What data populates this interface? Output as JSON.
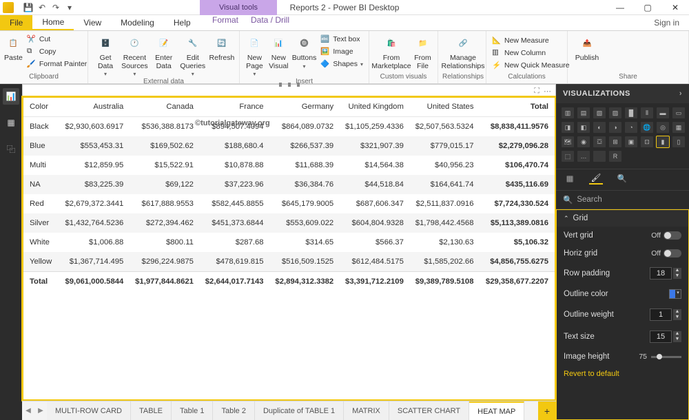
{
  "titlebar": {
    "visual_tools": "Visual tools",
    "app_title": "Reports 2 - Power BI Desktop"
  },
  "menu": {
    "file": "File",
    "tabs": [
      "Home",
      "View",
      "Modeling",
      "Help"
    ],
    "purple_tabs": [
      "Format",
      "Data / Drill"
    ],
    "signin": "Sign in"
  },
  "ribbon": {
    "clipboard": {
      "label": "Clipboard",
      "paste": "Paste",
      "cut": "Cut",
      "copy": "Copy",
      "format_painter": "Format Painter"
    },
    "external": {
      "label": "External data",
      "get_data": "Get\nData",
      "recent": "Recent\nSources",
      "enter": "Enter\nData",
      "edit": "Edit\nQueries",
      "refresh": "Refresh"
    },
    "insert": {
      "label": "Insert",
      "new_page": "New\nPage",
      "new_visual": "New\nVisual",
      "buttons": "Buttons",
      "text_box": "Text box",
      "image": "Image",
      "shapes": "Shapes"
    },
    "custom": {
      "label": "Custom visuals",
      "marketplace": "From\nMarketplace",
      "file": "From\nFile"
    },
    "relationships": {
      "label": "Relationships",
      "manage": "Manage\nRelationships"
    },
    "calc": {
      "label": "Calculations",
      "new_measure": "New Measure",
      "new_column": "New Column",
      "new_quick": "New Quick Measure"
    },
    "share": {
      "label": "Share",
      "publish": "Publish"
    }
  },
  "matrix": {
    "watermark": "©tutorialgateway.org",
    "row_header": "Color",
    "columns": [
      "Australia",
      "Canada",
      "France",
      "Germany",
      "United Kingdom",
      "United States",
      "Total"
    ],
    "rows": [
      {
        "k": "Black",
        "v": [
          "$2,930,603.6917",
          "$536,388.8173",
          "$894,507.4094",
          "$864,089.0732",
          "$1,105,259.4336",
          "$2,507,563.5324",
          "$8,838,411.9576"
        ]
      },
      {
        "k": "Blue",
        "v": [
          "$553,453.31",
          "$169,502.62",
          "$188,680.4",
          "$266,537.39",
          "$321,907.39",
          "$779,015.17",
          "$2,279,096.28"
        ]
      },
      {
        "k": "Multi",
        "v": [
          "$12,859.95",
          "$15,522.91",
          "$10,878.88",
          "$11,688.39",
          "$14,564.38",
          "$40,956.23",
          "$106,470.74"
        ]
      },
      {
        "k": "NA",
        "v": [
          "$83,225.39",
          "$69,122",
          "$37,223.96",
          "$36,384.76",
          "$44,518.84",
          "$164,641.74",
          "$435,116.69"
        ]
      },
      {
        "k": "Red",
        "v": [
          "$2,679,372.3441",
          "$617,888.9553",
          "$582,445.8855",
          "$645,179.9005",
          "$687,606.347",
          "$2,511,837.0916",
          "$7,724,330.524"
        ]
      },
      {
        "k": "Silver",
        "v": [
          "$1,432,764.5236",
          "$272,394.462",
          "$451,373.6844",
          "$553,609.022",
          "$604,804.9328",
          "$1,798,442.4568",
          "$5,113,389.0816"
        ]
      },
      {
        "k": "White",
        "v": [
          "$1,006.88",
          "$800.11",
          "$287.68",
          "$314.65",
          "$566.37",
          "$2,130.63",
          "$5,106.32"
        ]
      },
      {
        "k": "Yellow",
        "v": [
          "$1,367,714.495",
          "$296,224.9875",
          "$478,619.815",
          "$516,509.1525",
          "$612,484.5175",
          "$1,585,202.66",
          "$4,856,755.6275"
        ]
      }
    ],
    "total_label": "Total",
    "totals": [
      "$9,061,000.5844",
      "$1,977,844.8621",
      "$2,644,017.7143",
      "$2,894,312.3382",
      "$3,391,712.2109",
      "$9,389,789.5108",
      "$29,358,677.2207"
    ]
  },
  "sheets": {
    "tabs": [
      "MULTI-ROW CARD",
      "TABLE",
      "Table 1",
      "Table 2",
      "Duplicate of TABLE 1",
      "MATRIX",
      "SCATTER CHART",
      "HEAT MAP"
    ],
    "active": 7
  },
  "rightpane": {
    "title": "VISUALIZATIONS",
    "search": "Search",
    "section": "Grid",
    "vert_grid": "Vert grid",
    "horiz_grid": "Horiz grid",
    "off": "Off",
    "row_padding": "Row padding",
    "row_padding_val": "18",
    "outline_color": "Outline color",
    "outline_weight": "Outline weight",
    "outline_weight_val": "1",
    "text_size": "Text size",
    "text_size_val": "15",
    "image_height": "Image height",
    "image_height_val": "75",
    "revert": "Revert to default"
  }
}
